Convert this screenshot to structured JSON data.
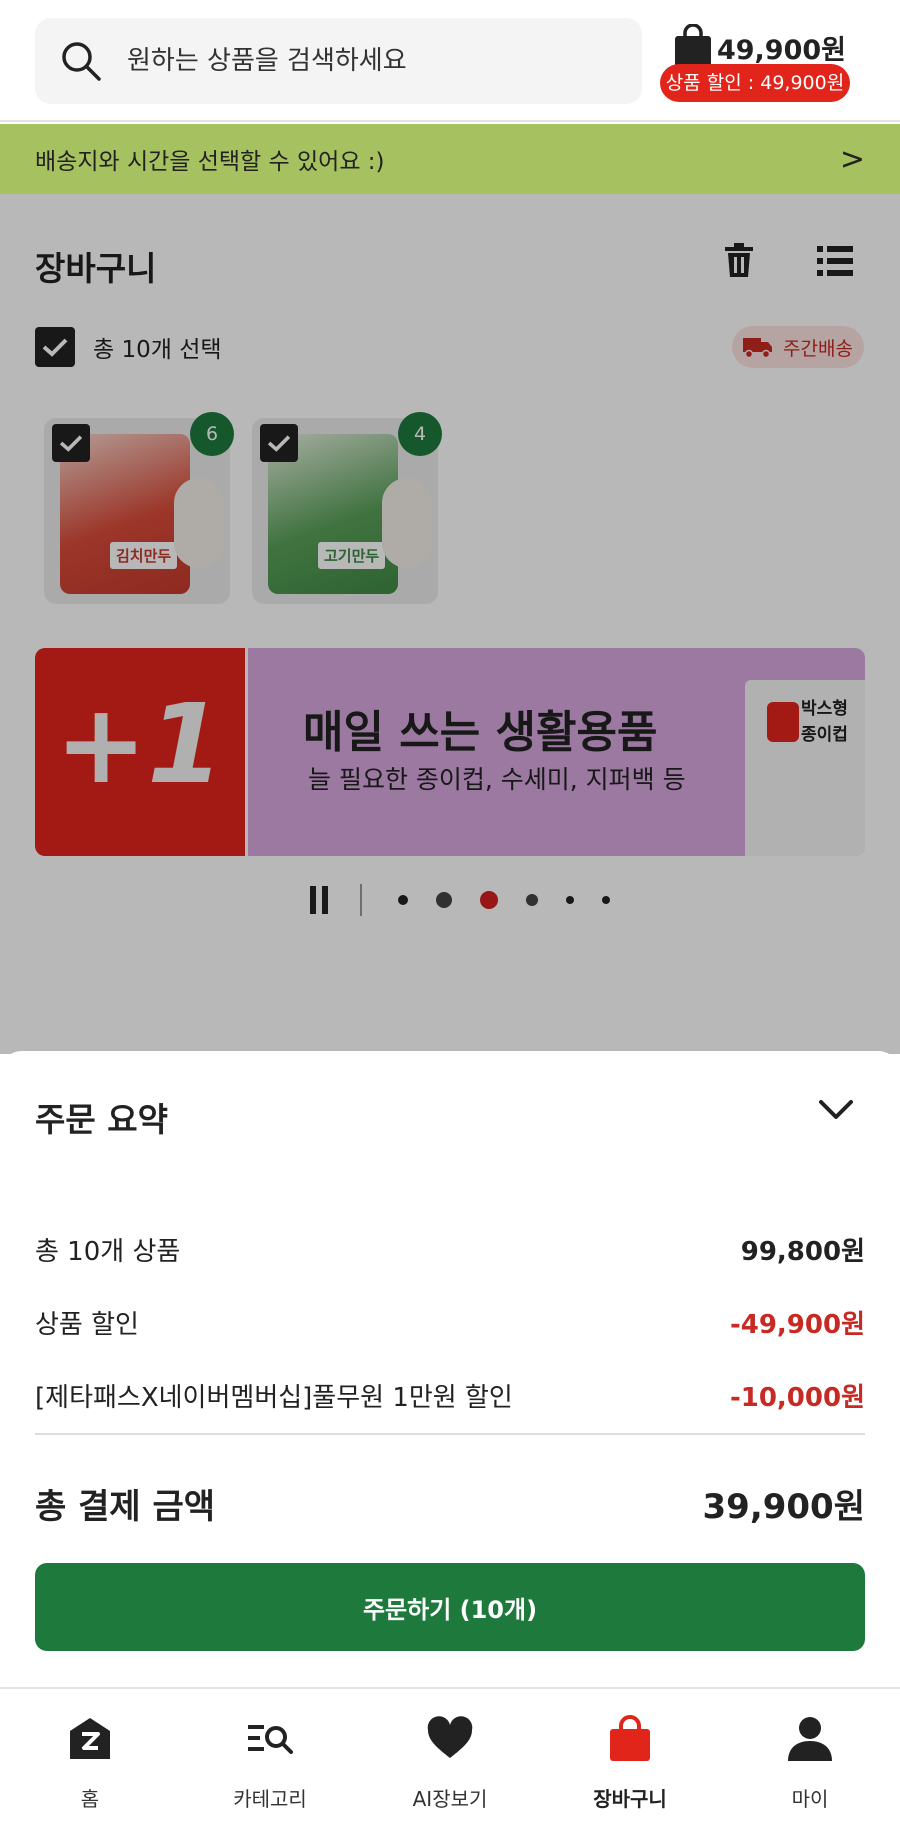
{
  "header": {
    "search_placeholder": "원하는 상품을 검색하세요",
    "cart_total": "49,900원",
    "discount_badge": "상품 할인 : 49,900원"
  },
  "delivery": {
    "text": "배송지와 시간을 선택할 수 있어요 :)",
    "arrow": ">"
  },
  "cart": {
    "title": "장바구니",
    "select_all_label": "총 10개 선택",
    "shipping_badge": "주간배송",
    "items": [
      {
        "label": "김치만두",
        "quantity": "6"
      },
      {
        "label": "고기만두",
        "quantity": "4"
      }
    ]
  },
  "banner": {
    "left_text": "+1",
    "headline": "매일 쓰는 생활용품",
    "subline": "늘 필요한 종이컵, 수세미, 지퍼백 등",
    "product_text_1": "박스형",
    "product_text_2": "종이컵"
  },
  "summary": {
    "title": "주문 요약",
    "rows": [
      {
        "label": "총 10개 상품",
        "value": "99,800원"
      },
      {
        "label": "상품 할인",
        "value": "-49,900원"
      },
      {
        "label": "[제타패스X네이버멤버십]풀무원 1만원 할인",
        "value": "-10,000원"
      }
    ],
    "total_label": "총 결제 금액",
    "total_value": "39,900원",
    "order_button": "주문하기 (10개)"
  },
  "tabbar": {
    "tabs": [
      {
        "label": "홈"
      },
      {
        "label": "카테고리"
      },
      {
        "label": "AI장보기"
      },
      {
        "label": "장바구니"
      },
      {
        "label": "마이"
      }
    ]
  },
  "colors": {
    "brand_green": "#1e7a3c",
    "accent_red": "#e1251b",
    "delivery_bar": "#a6c15f"
  }
}
